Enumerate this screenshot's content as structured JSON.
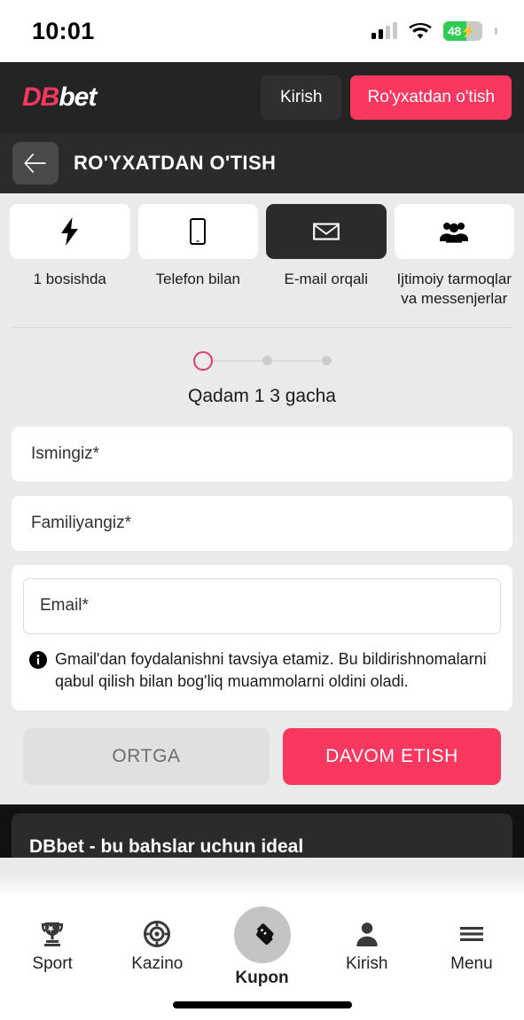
{
  "status_bar": {
    "time": "10:01",
    "signal_icon": "cellular-signal-icon",
    "wifi_icon": "wifi-icon",
    "battery_percent": "48",
    "battery_charging": true,
    "battery_icon": "battery-charging-icon"
  },
  "header": {
    "logo_part1": "DB",
    "logo_part2": "bet",
    "login_label": "Kirish",
    "register_label": "Ro'yxatdan o'tish",
    "accent_color": "#f9375f",
    "background_color": "#242424"
  },
  "subheader": {
    "back_icon": "back-arrow-icon",
    "title": "RO'YXATDAN O'TISH"
  },
  "methods": [
    {
      "icon": "lightning-bolt-icon",
      "label": "1 bosishda",
      "active": false
    },
    {
      "icon": "mobile-phone-icon",
      "label": "Telefon bilan",
      "active": false
    },
    {
      "icon": "envelope-icon",
      "label": "E-mail orqali",
      "active": true
    },
    {
      "icon": "people-group-icon",
      "label": "Ijtimoiy tarmoqlar va messenjerlar",
      "active": false
    }
  ],
  "stepper": {
    "current": 1,
    "total": 3,
    "label": "Qadam 1 3 gacha",
    "active_color": "#e03a6d",
    "inactive_color": "#cccccc"
  },
  "form": {
    "first_name": {
      "placeholder": "Ismingiz*",
      "value": ""
    },
    "last_name": {
      "placeholder": "Familiyangiz*",
      "value": ""
    },
    "email": {
      "placeholder": "Email*",
      "value": ""
    },
    "note_icon": "info-circle-icon",
    "note_text": "Gmail'dan foydalanishni tavsiya etamiz. Bu bildirishnomalarni qabul qilish bilan bog'liq muammolarni oldini oladi."
  },
  "actions": {
    "back_label": "ORTGA",
    "next_label": "DAVOM ETISH"
  },
  "promo": {
    "text": "DBbet - bu bahslar uchun ideal"
  },
  "bottom_nav": [
    {
      "icon": "trophy-icon",
      "label": "Sport",
      "active": false
    },
    {
      "icon": "casino-chip-icon",
      "label": "Kazino",
      "active": false
    },
    {
      "icon": "coupon-ticket-icon",
      "label": "Kupon",
      "active": true
    },
    {
      "icon": "person-icon",
      "label": "Kirish",
      "active": false
    },
    {
      "icon": "hamburger-menu-icon",
      "label": "Menu",
      "active": false
    }
  ]
}
